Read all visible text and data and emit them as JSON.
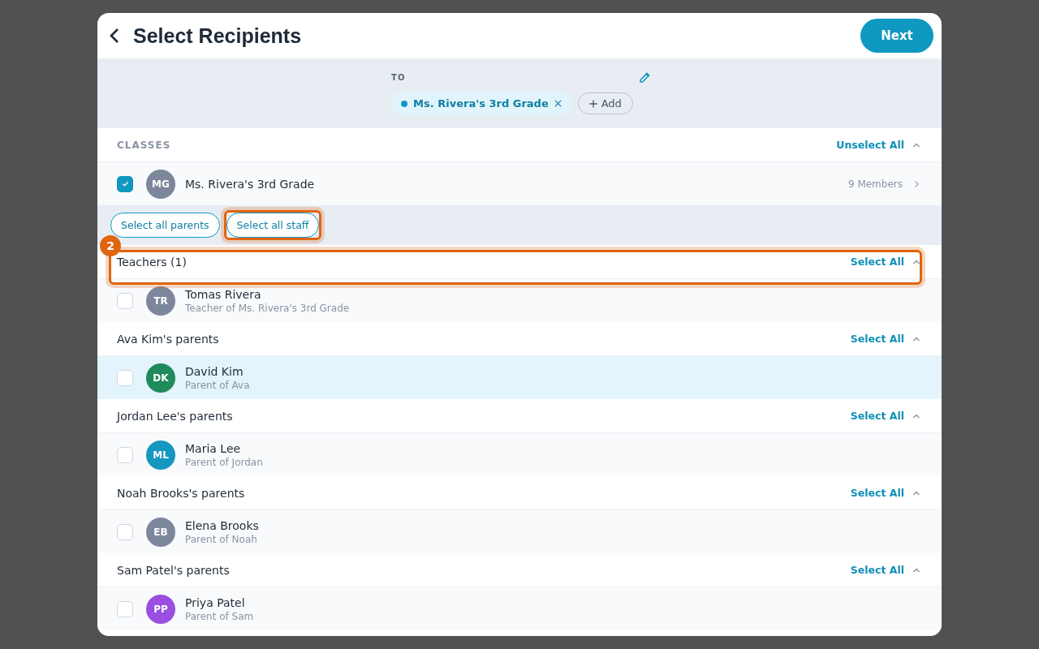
{
  "header": {
    "title": "Select Recipients",
    "next_button": "Next"
  },
  "to_panel": {
    "label": "TO",
    "chips": [
      {
        "label": "Ms. Rivera's 3rd Grade",
        "color": "#1597c0"
      }
    ],
    "add_button": "Add"
  },
  "classes": {
    "heading": "CLASSES",
    "action": "Unselect All",
    "expanded": true,
    "items": [
      {
        "initials": "MG",
        "color": "#7c879c",
        "name": "Ms. Rivera's 3rd Grade",
        "members": "9 Members",
        "checked": true
      }
    ]
  },
  "quick_buttons": [
    {
      "label": "Select all parents",
      "highlighted": false
    },
    {
      "label": "Select all staff",
      "highlighted": true
    }
  ],
  "groups": [
    {
      "title": "Teachers (1)",
      "action": "Select All",
      "expanded": true,
      "highlighted": true,
      "members": [
        {
          "initials": "TR",
          "color": "#7c879c",
          "name": "Tomas Rivera",
          "subtitle": "Teacher of Ms. Rivera's 3rd Grade",
          "checked": false,
          "hovered": false
        }
      ]
    },
    {
      "title": "Ava Kim's parents",
      "action": "Select All",
      "expanded": true,
      "highlighted": false,
      "members": [
        {
          "initials": "DK",
          "color": "#1f8a5b",
          "name": "David Kim",
          "subtitle": "Parent of Ava",
          "checked": false,
          "hovered": true
        }
      ]
    },
    {
      "title": "Jordan Lee's parents",
      "action": "Select All",
      "expanded": true,
      "highlighted": false,
      "members": [
        {
          "initials": "ML",
          "color": "#1597c0",
          "name": "Maria Lee",
          "subtitle": "Parent of Jordan",
          "checked": false,
          "hovered": false
        }
      ]
    },
    {
      "title": "Noah Brooks's parents",
      "action": "Select All",
      "expanded": true,
      "highlighted": false,
      "members": [
        {
          "initials": "EB",
          "color": "#7c879c",
          "name": "Elena Brooks",
          "subtitle": "Parent of Noah",
          "checked": false,
          "hovered": false
        }
      ]
    },
    {
      "title": "Sam Patel's parents",
      "action": "Select All",
      "expanded": true,
      "highlighted": false,
      "members": [
        {
          "initials": "PP",
          "color": "#9b4fe0",
          "name": "Priya Patel",
          "subtitle": "Parent of Sam",
          "checked": false,
          "hovered": false
        }
      ]
    }
  ],
  "annotation": {
    "badge": "2"
  }
}
